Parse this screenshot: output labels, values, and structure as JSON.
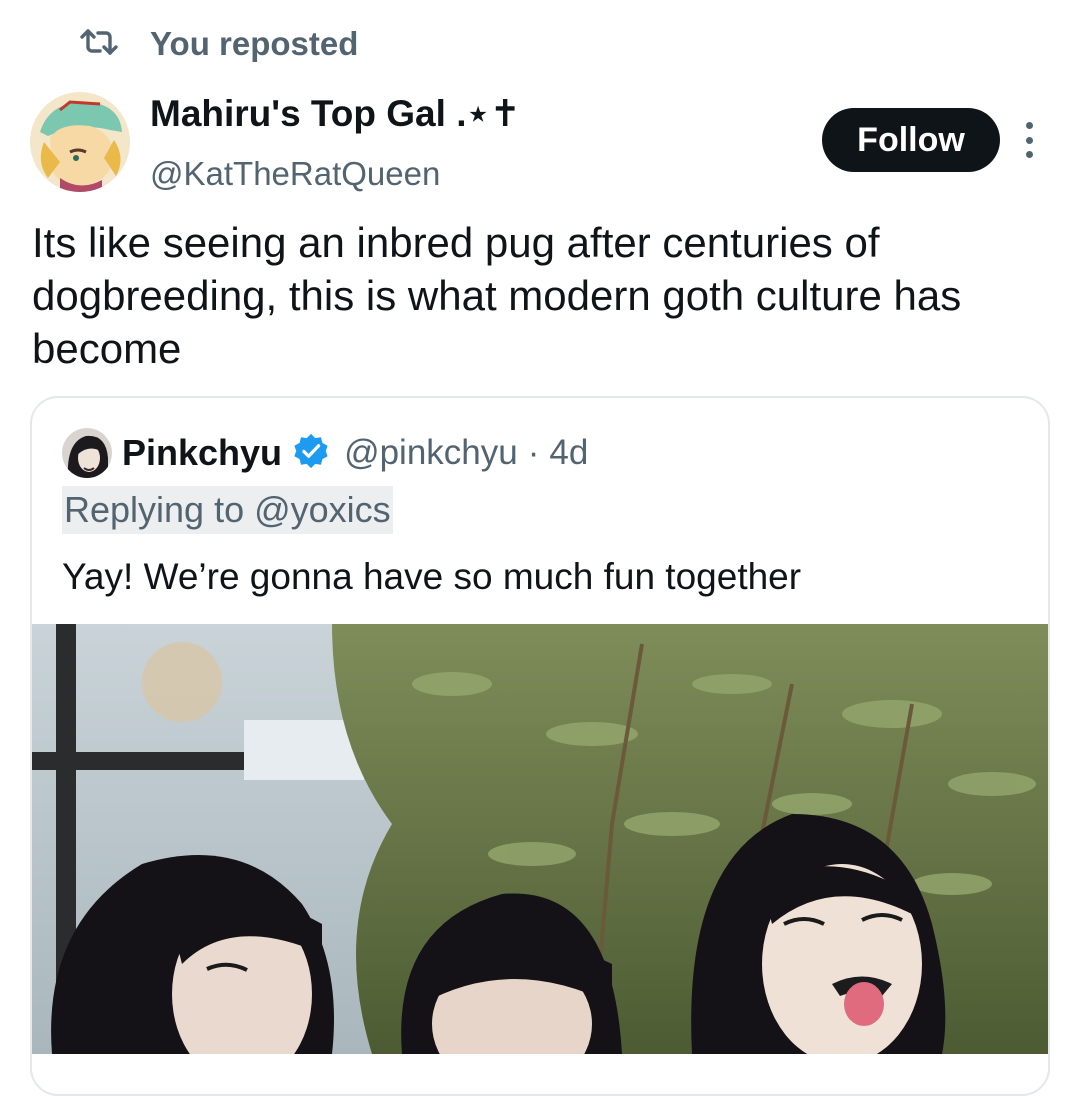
{
  "repost": {
    "label": "You reposted",
    "icon": "repost-icon"
  },
  "tweet": {
    "author_name": "Mahiru's Top Gal .⋆✝",
    "author_handle": "@KatTheRatQueen",
    "follow_label": "Follow",
    "text": "Its like seeing an inbred pug after centuries of dogbreeding, this is what modern goth culture has become"
  },
  "quote": {
    "name": "Pinkchyu",
    "verified_icon": "verified-badge-icon",
    "handle": "@pinkchyu",
    "separator": "·",
    "time": "4d",
    "replying_to": "Replying to @yoxics",
    "text": "Yay! We’re gonna have so much fun together"
  },
  "colors": {
    "text_primary": "#0f1419",
    "text_secondary": "#536471",
    "follow_bg": "#0f1419",
    "verified_blue": "#1d9bf0",
    "card_border": "#e4e8eb"
  }
}
